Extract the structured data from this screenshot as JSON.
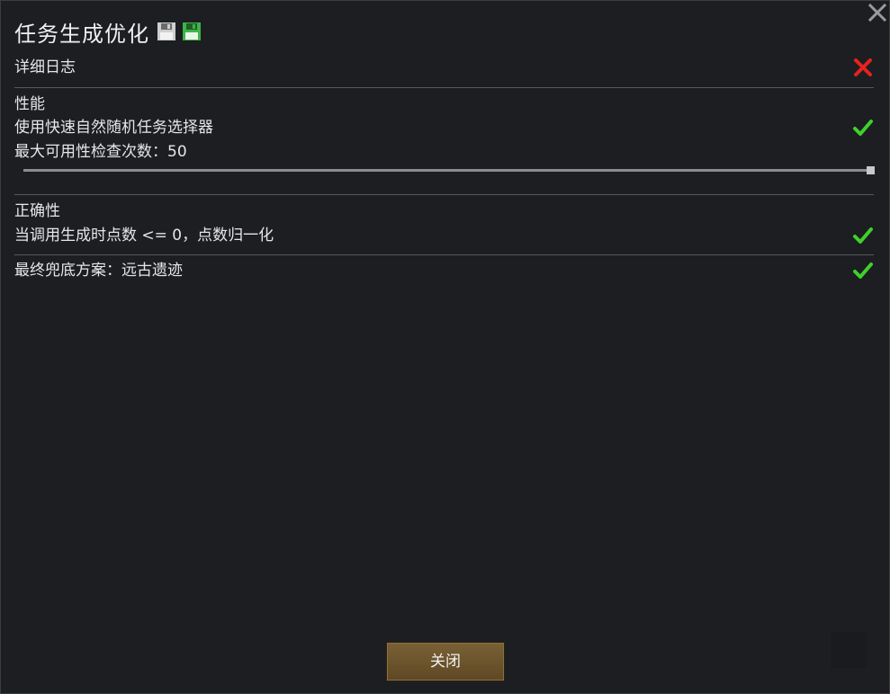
{
  "window": {
    "title": "任务生成优化",
    "close_icon": "close-icon",
    "save_icons": [
      "save-icon-gray",
      "save-icon-green"
    ]
  },
  "settings": {
    "verbose_log": {
      "label": "详细日志",
      "enabled": false
    },
    "performance_header": "性能",
    "fast_selector": {
      "label": "使用快速自然随机任务选择器",
      "enabled": true
    },
    "max_checks": {
      "label": "最大可用性检查次数：50",
      "value": 50,
      "fraction": 1.0
    },
    "correctness_header": "正确性",
    "normalize_points": {
      "label": "当调用生成时点数 <= 0，点数归一化",
      "enabled": true
    },
    "fallback": {
      "label": "最终兜底方案：远古遗迹",
      "enabled": true
    }
  },
  "footer": {
    "close_label": "关闭"
  },
  "colors": {
    "check_green": "#3fd12a",
    "cross_red": "#e6221f",
    "button_brown": "#6b5230",
    "background": "#1c1e22"
  }
}
